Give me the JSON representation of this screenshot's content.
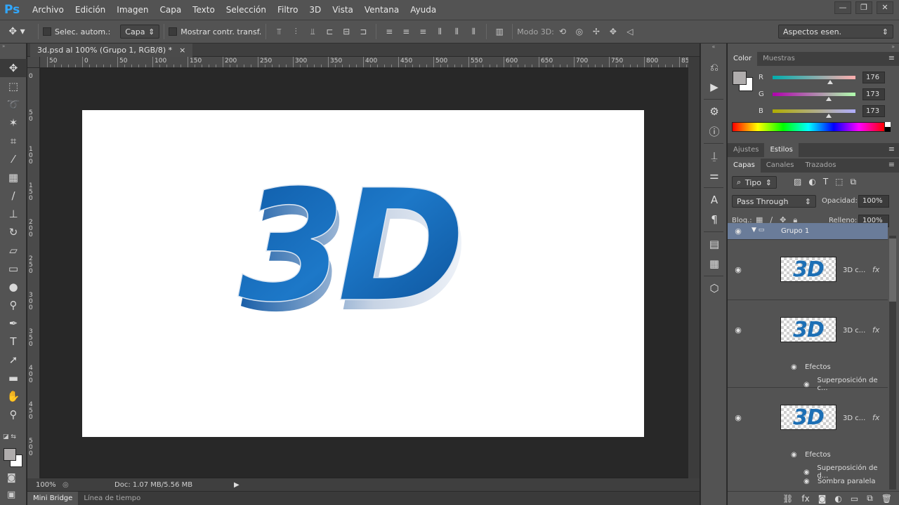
{
  "app": {
    "logo": "Ps"
  },
  "menu": [
    "Archivo",
    "Edición",
    "Imagen",
    "Capa",
    "Texto",
    "Selección",
    "Filtro",
    "3D",
    "Vista",
    "Ventana",
    "Ayuda"
  ],
  "window_controls": {
    "minimize": "—",
    "restore": "❐",
    "close": "✕"
  },
  "options": {
    "auto_select_label": "Selec. autom.:",
    "auto_select_value": "Capa",
    "show_transform_label": "Mostrar contr. transf.",
    "mode3d_label": "Modo 3D:",
    "workspace": "Aspectos esen."
  },
  "document": {
    "tab_title": "3d.psd al 100% (Grupo 1, RGB/8) *",
    "tab_close": "×",
    "artwork_text": "3D",
    "zoom": "100%",
    "doc_info": "Doc: 1.07 MB/5.56 MB"
  },
  "ruler_h_labels": [
    "50",
    "0",
    "50",
    "100",
    "150",
    "200",
    "250",
    "300",
    "350",
    "400",
    "450",
    "500",
    "550",
    "600",
    "650",
    "700",
    "750",
    "800",
    "85"
  ],
  "ruler_v_labels": [
    "0",
    "5 0",
    "1 0 0",
    "1 5 0",
    "2 0 0",
    "2 5 0",
    "3 0 0",
    "3 5 0",
    "4 0 0",
    "4 5 0",
    "5 0 0"
  ],
  "bottom_tabs": [
    "Mini Bridge",
    "Línea de tiempo"
  ],
  "color_panel": {
    "tabs": [
      "Color",
      "Muestras"
    ],
    "sliders": [
      {
        "label": "R",
        "value": "176"
      },
      {
        "label": "G",
        "value": "173"
      },
      {
        "label": "B",
        "value": "173"
      }
    ],
    "foreground": "#b0adad"
  },
  "adjust_panel": {
    "tabs": [
      "Ajustes",
      "Estilos"
    ]
  },
  "layers_panel": {
    "tabs": [
      "Capas",
      "Canales",
      "Trazados"
    ],
    "filter_label": "Tipo",
    "blend_mode": "Pass Through",
    "opacity_label": "Opacidad:",
    "opacity_value": "100%",
    "lock_label": "Bloq.:",
    "fill_label": "Relleno:",
    "fill_value": "100%",
    "group_name": "Grupo 1",
    "layers": [
      {
        "name": "3D c...",
        "thumb": "3D",
        "effects": []
      },
      {
        "name": "3D c...",
        "thumb": "3D",
        "effects_label": "Efectos",
        "effects": [
          "Superposición de c..."
        ]
      },
      {
        "name": "3D c...",
        "thumb": "3D",
        "effects_label": "Efectos",
        "effects": [
          "Superposición de d...",
          "Sombra paralela"
        ]
      }
    ]
  },
  "colors": {
    "accent": "#31a8ff",
    "artwork_blue": "#1466b0",
    "canvas": "#ffffff",
    "workspace_bg": "#282828",
    "panel_bg": "#535353"
  }
}
